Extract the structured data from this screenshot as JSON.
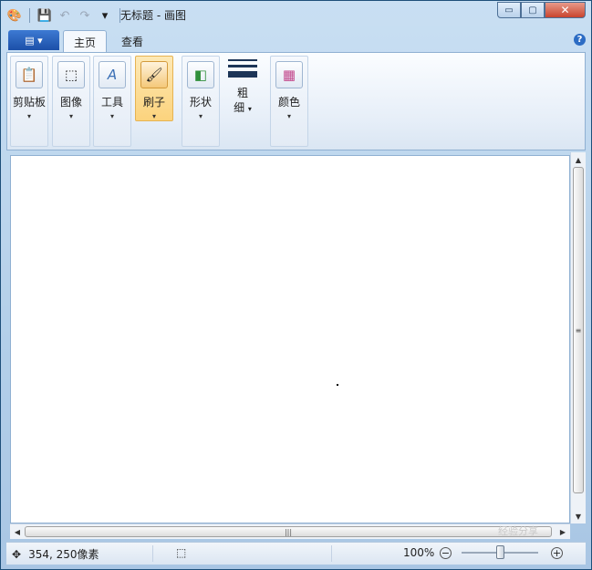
{
  "window": {
    "title": "无标题 - 画图",
    "caption": {
      "minimize": "▭",
      "maximize": "▢",
      "close": "✕"
    }
  },
  "qat": {
    "paint_icon": "paint-icon",
    "save_icon": "💾",
    "undo_icon": "↶",
    "redo_icon": "↷",
    "customize": "▾"
  },
  "tabs": {
    "app_menu": "▤ ▾",
    "home": "主页",
    "view": "查看",
    "help": "?"
  },
  "ribbon": {
    "clipboard": {
      "label": "剪贴板",
      "icon": "📋"
    },
    "image": {
      "label": "图像",
      "icon": "⬚"
    },
    "tools": {
      "label": "工具",
      "icon": "A"
    },
    "brushes": {
      "label": "刷子",
      "icon": "🖌"
    },
    "shapes": {
      "label": "形状",
      "icon": "◧"
    },
    "size": {
      "label_line1": "粗",
      "label_line2": "细"
    },
    "colors": {
      "label": "颜色",
      "icon": "▦"
    },
    "arrow": "▾"
  },
  "scrollbars": {
    "up": "▲",
    "down": "▼",
    "left": "◀",
    "right": "▶",
    "grip_v": "≡",
    "grip_h": "|||"
  },
  "status": {
    "position_icon": "✥",
    "position": "354, 250像素",
    "selection_icon": "⬚",
    "zoom": "100%",
    "zoom_out": "−",
    "zoom_in": "+",
    "zoom_level": 0.5
  },
  "watermark": "经验分享"
}
